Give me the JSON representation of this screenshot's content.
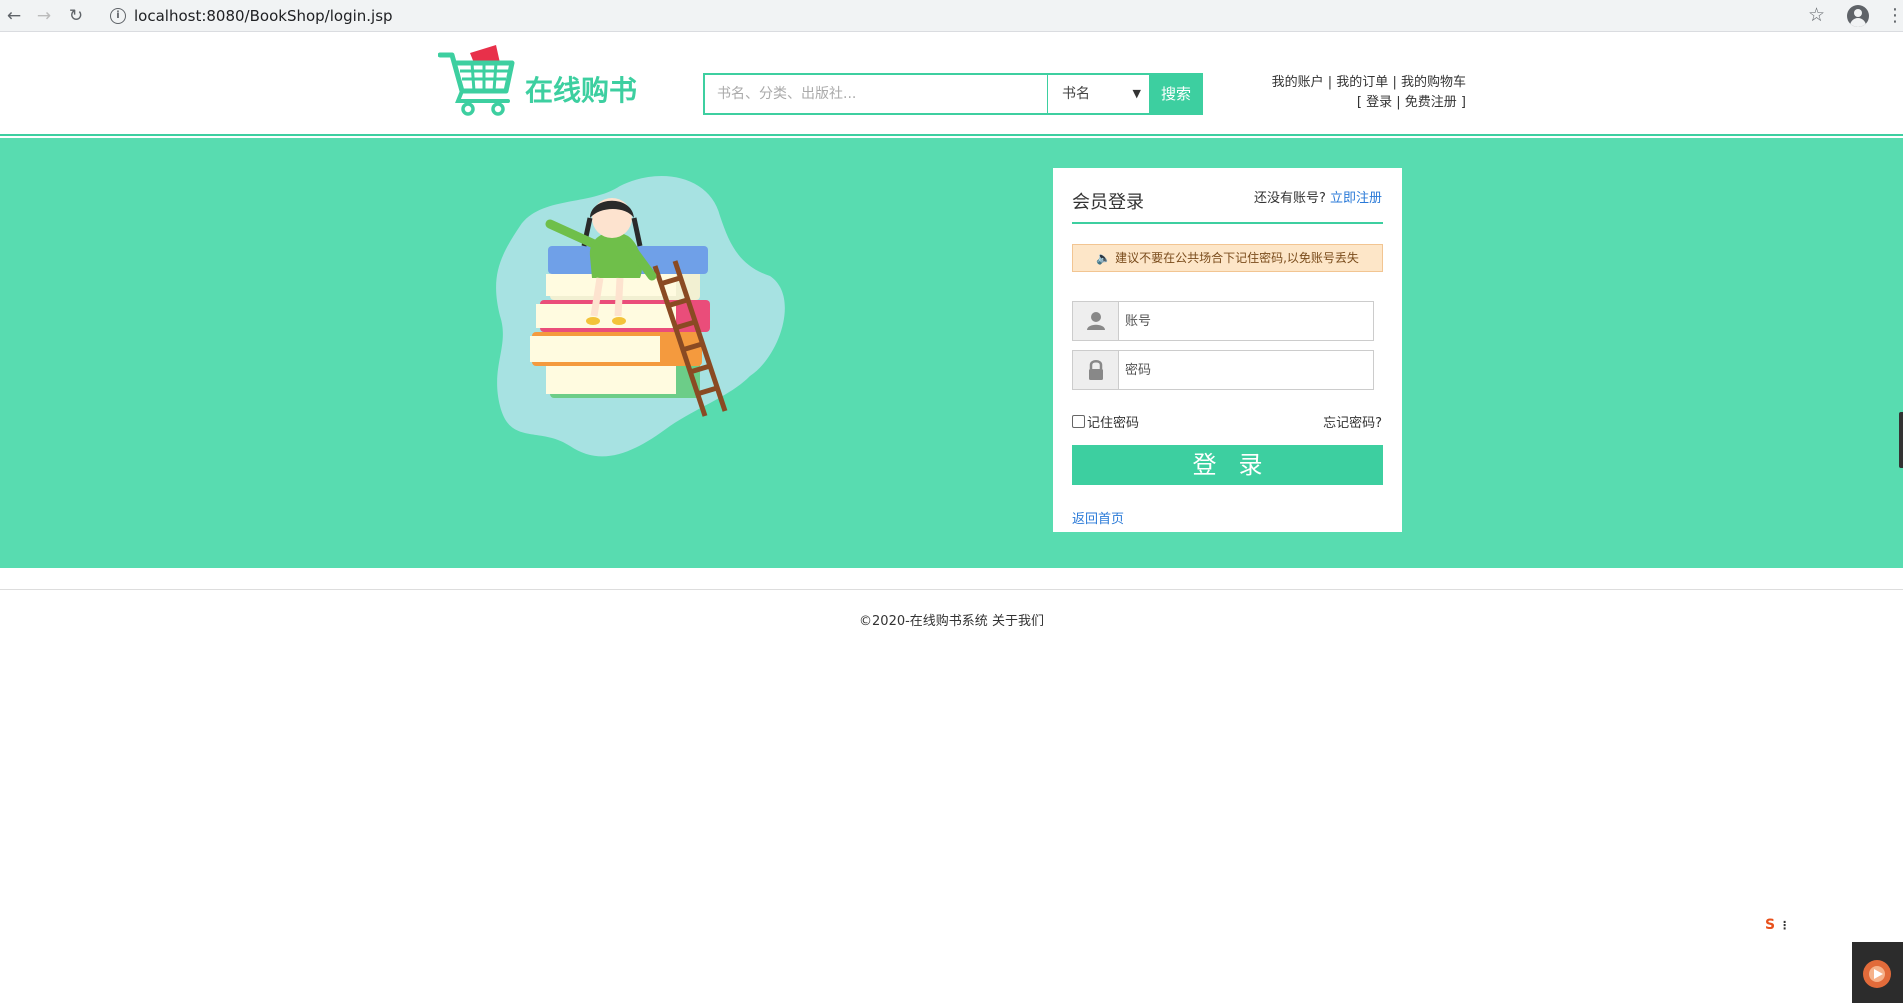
{
  "browser": {
    "url": "localhost:8080/BookShop/login.jsp",
    "icons": [
      "back-icon",
      "forward-icon",
      "reload-icon",
      "info-icon",
      "star-icon",
      "account-icon",
      "menu-icon"
    ]
  },
  "header": {
    "logo_text": "在线购书",
    "search": {
      "placeholder": "书名、分类、出版社...",
      "category_selected": "书名",
      "button_label": "搜索"
    },
    "links": {
      "my_account": "我的账户",
      "my_orders": "我的订单",
      "my_cart": "我的购物车",
      "sep": "|",
      "bracket_open": "[",
      "login": "登录",
      "register": "免费注册",
      "bracket_close": "]"
    }
  },
  "login": {
    "title": "会员登录",
    "no_account": "还没有账号?",
    "register_now": "立即注册",
    "notice": "建议不要在公共场合下记住密码,以免账号丢失",
    "account_placeholder": "账号",
    "password_placeholder": "密码",
    "remember": "记住密码",
    "forgot": "忘记密码?",
    "submit": "登录",
    "back_home": "返回首页"
  },
  "footer": {
    "copyright": "©2020-在线购书系统",
    "about": "关于我们"
  },
  "ime": {
    "label": "S"
  },
  "colors": {
    "accent": "#3dcfa0",
    "band": "#58dcb0",
    "link": "#2a7ad8",
    "notice_bg": "#fde6c8"
  }
}
